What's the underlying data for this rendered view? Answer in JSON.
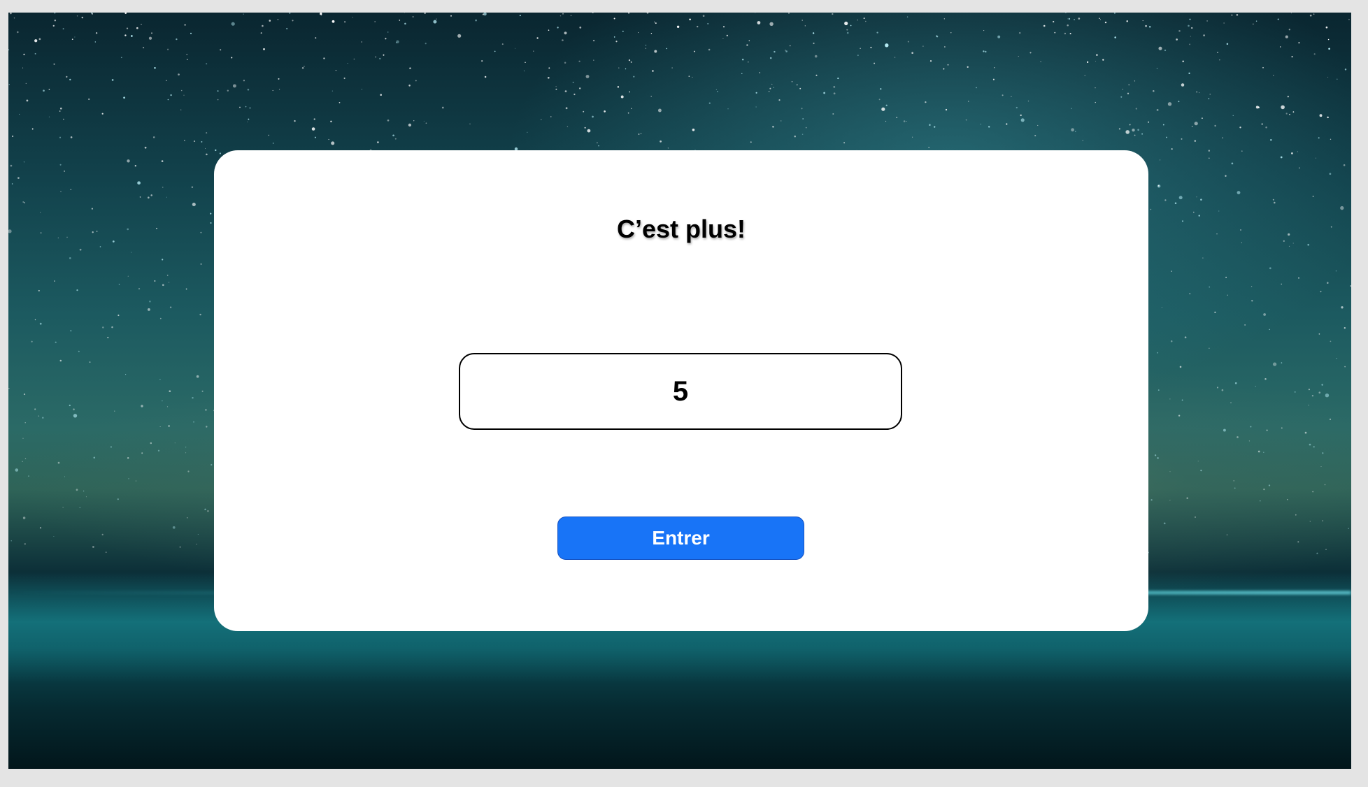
{
  "game": {
    "feedback": "C’est plus!",
    "guess_value": "5",
    "submit_label": "Entrer"
  },
  "colors": {
    "button_bg": "#1874f7",
    "card_bg": "#ffffff",
    "page_bg": "#e4e4e4"
  }
}
